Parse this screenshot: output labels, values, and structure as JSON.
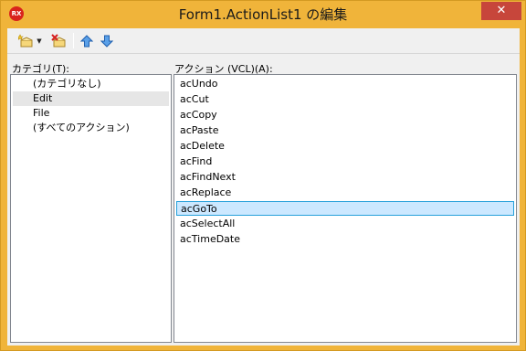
{
  "window": {
    "title": "Form1.ActionList1 の編集",
    "logo_text": "RX",
    "close_glyph": "✕",
    "accent_color": "#f0b43a",
    "close_color": "#c7463b"
  },
  "toolbar": {
    "buttons": [
      {
        "name": "new-action-icon"
      },
      {
        "name": "delete-action-icon"
      },
      {
        "name": "move-up-icon"
      },
      {
        "name": "move-down-icon"
      }
    ],
    "dropdown_glyph": "▼"
  },
  "categories": {
    "label": "カテゴリ(T):",
    "items": [
      "(カテゴリなし)",
      "Edit",
      "File",
      "(すべてのアクション)"
    ],
    "selected": "Edit"
  },
  "actions": {
    "label": "アクション (VCL)(A):",
    "items": [
      "acUndo",
      "acCut",
      "acCopy",
      "acPaste",
      "acDelete",
      "acFind",
      "acFindNext",
      "acReplace",
      "acGoTo",
      "acSelectAll",
      "acTimeDate"
    ],
    "selected": "acGoTo"
  }
}
